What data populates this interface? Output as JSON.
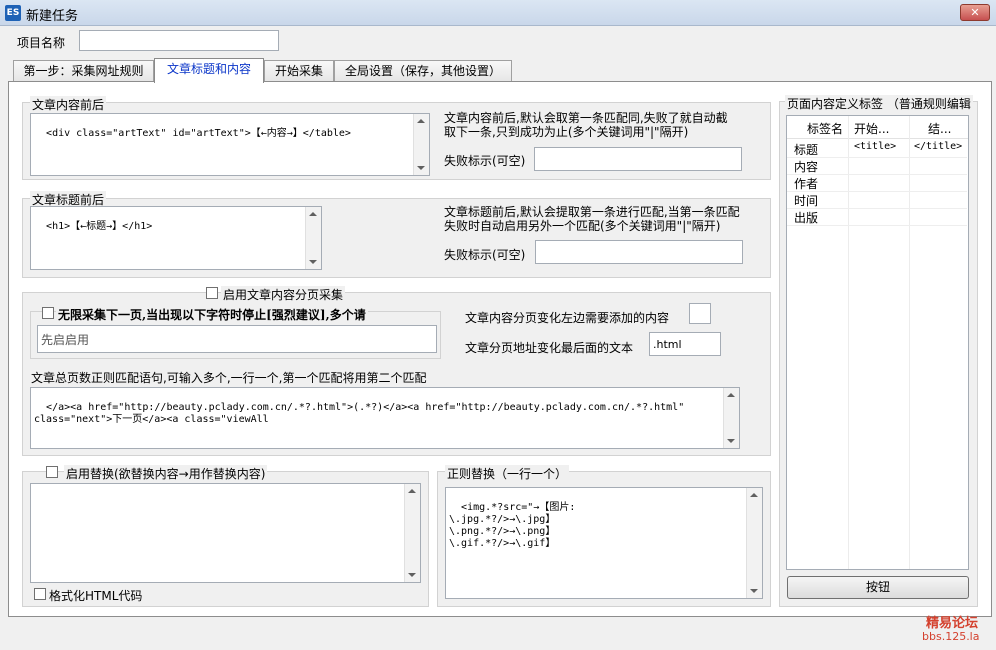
{
  "window": {
    "title": "新建任务",
    "app_icon": "ES",
    "close_glyph": "✕"
  },
  "project": {
    "label": "项目名称",
    "value": ""
  },
  "tabs": [
    {
      "label": "第一步：采集网址规则"
    },
    {
      "label": "文章标题和内容"
    },
    {
      "label": "开始采集"
    },
    {
      "label": "全局设置（保存，其他设置）"
    }
  ],
  "content_section": {
    "title": "文章内容前后",
    "text": "<div class=\"artText\" id=\"artText\">【←内容→】</table>",
    "hint": "文章内容前后,默认会取第一条匹配同,失败了就自动截取下一条,只到成功为止(多个关键词用\"|\"隔开)",
    "fail_label": "失败标示(可空)",
    "fail_value": ""
  },
  "title_section": {
    "title": "文章标题前后",
    "text": "<h1>【←标题→】</h1>",
    "hint": "文章标题前后,默认会提取第一条进行匹配,当第一条匹配失败时自动启用另外一个匹配(多个关键词用\"|\"隔开)",
    "fail_label": "失败标示(可空)",
    "fail_value": ""
  },
  "paging": {
    "enable_label": "启用文章内容分页采集",
    "infinite_label": "无限采集下一页,当出现以下字符时停止[强烈建议],多个请",
    "infinite_placeholder": "先启启用",
    "left_add_label": "文章内容分页变化左边需要添加的内容",
    "left_add_value": "",
    "suffix_label": "文章分页地址变化最后面的文本",
    "suffix_value": ".html",
    "regex_label": "文章总页数正则匹配语句,可输入多个,一行一个,第一个匹配将用第二个匹配",
    "regex_text": "</a><a href=\"http://beauty.pclady.com.cn/.*?.html\">(.*?)</a><a href=\"http://beauty.pclady.com.cn/.*?.html\" class=\"next\">下一页</a><a class=\"viewAll"
  },
  "replace": {
    "enable_label": "启用替换(欲替换内容→用作替换内容)",
    "text": "",
    "format_label": "格式化HTML代码"
  },
  "regex_replace": {
    "title": "正则替换（一行一个）",
    "text": "<img.*?src=\"→【图片:\n\\.jpg.*?/>→\\.jpg】\n\\.png.*?/>→\\.png】\n\\.gif.*?/>→\\.gif】"
  },
  "tags_panel": {
    "title": "页面内容定义标签  （普通规则编辑",
    "headers": [
      "标签名",
      "开始...",
      "结..."
    ],
    "rows": [
      {
        "name": "标题",
        "start": "<title>",
        "end": "</title>"
      },
      {
        "name": "内容",
        "start": "",
        "end": ""
      },
      {
        "name": "作者",
        "start": "",
        "end": ""
      },
      {
        "name": "时间",
        "start": "",
        "end": ""
      },
      {
        "name": "出版",
        "start": "",
        "end": ""
      }
    ],
    "button_label": "按钮"
  },
  "watermark": {
    "line1": "精易论坛",
    "line2": "bbs.125.la"
  }
}
